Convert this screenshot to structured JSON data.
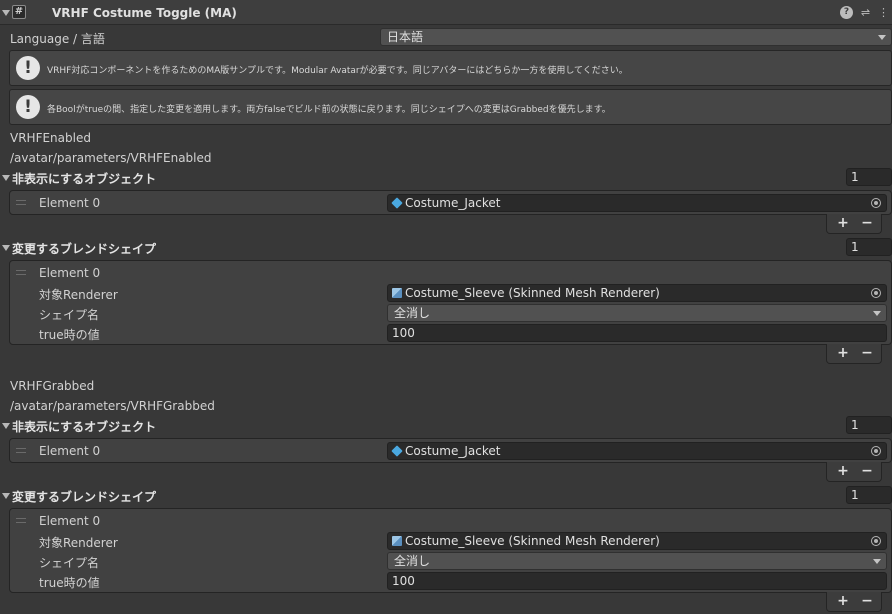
{
  "header": {
    "title": "VRHF Costume Toggle (MA)",
    "script_icon": "hash-script-icon",
    "icons": [
      "help-icon",
      "settings-sliders-icon",
      "more-vertical-icon"
    ]
  },
  "language": {
    "label": "Language / 言語",
    "value": "日本語"
  },
  "help": [
    "VRHF対応コンポーネントを作るためのMA版サンプルです。Modular Avatarが必要です。同じアバターにはどちらか一方を使用してください。",
    "各Boolがtrueの間、指定した変更を適用します。両方falseでビルド前の状態に戻ります。同じシェイプへの変更はGrabbedを優先します。"
  ],
  "sections": [
    {
      "name": "VRHFEnabled",
      "path": "/avatar/parameters/VRHFEnabled",
      "objects": {
        "title": "非表示にするオブジェクト",
        "size": "1",
        "element_label": "Element 0",
        "value": "Costume_Jacket"
      },
      "blendshapes": {
        "title": "変更するブレンドシェイプ",
        "size": "1",
        "element_label": "Element 0",
        "renderer_label": "対象Renderer",
        "renderer_value": "Costume_Sleeve (Skinned Mesh Renderer)",
        "shape_label": "シェイプ名",
        "shape_value": "全消し",
        "true_label": "true時の値",
        "true_value": "100"
      }
    },
    {
      "name": "VRHFGrabbed",
      "path": "/avatar/parameters/VRHFGrabbed",
      "objects": {
        "title": "非表示にするオブジェクト",
        "size": "1",
        "element_label": "Element 0",
        "value": "Costume_Jacket"
      },
      "blendshapes": {
        "title": "変更するブレンドシェイプ",
        "size": "1",
        "element_label": "Element 0",
        "renderer_label": "対象Renderer",
        "renderer_value": "Costume_Sleeve (Skinned Mesh Renderer)",
        "shape_label": "シェイプ名",
        "shape_value": "全消し",
        "true_label": "true時の値",
        "true_value": "100"
      }
    }
  ],
  "list_buttons": {
    "add": "+",
    "remove": "−"
  }
}
